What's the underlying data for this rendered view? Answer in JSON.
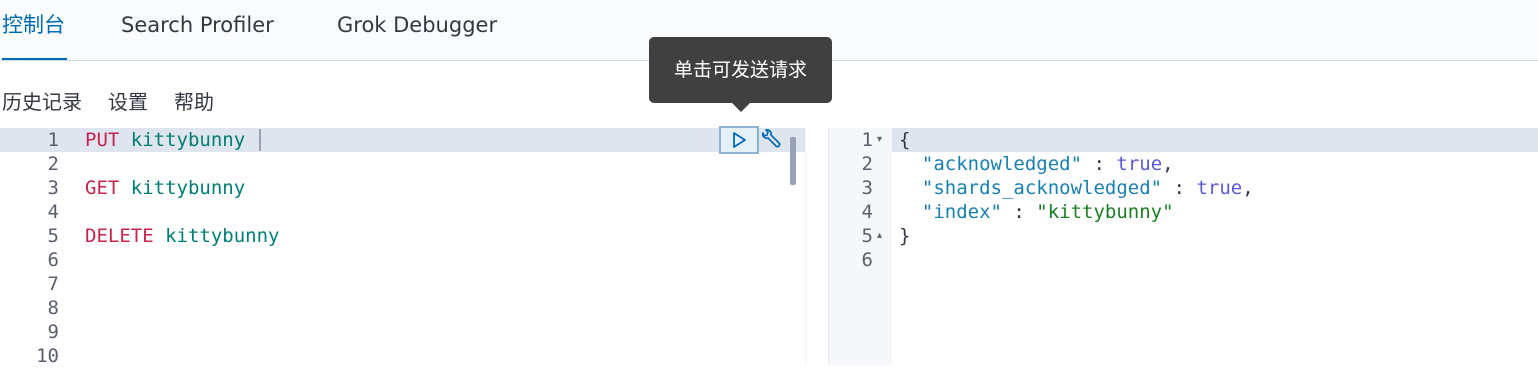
{
  "tabs": [
    {
      "label": "控制台",
      "active": true
    },
    {
      "label": "Search Profiler",
      "active": false
    },
    {
      "label": "Grok Debugger",
      "active": false
    }
  ],
  "menu": {
    "history": "历史记录",
    "settings": "设置",
    "help": "帮助"
  },
  "tooltip": {
    "text": "单击可发送请求"
  },
  "request_editor": {
    "line_numbers": [
      "1",
      "2",
      "3",
      "4",
      "5",
      "6",
      "7",
      "8",
      "9",
      "10"
    ],
    "lines": [
      {
        "method": "PUT",
        "url": "kittybunny"
      },
      {
        "method": "GET",
        "url": "kittybunny"
      },
      {
        "method": "DELETE",
        "url": "kittybunny"
      }
    ]
  },
  "response_editor": {
    "line_numbers": [
      "1",
      "2",
      "3",
      "4",
      "5",
      "6"
    ],
    "open_brace": "{",
    "close_brace": "}",
    "fields": [
      {
        "key": "\"acknowledged\"",
        "sep": " : ",
        "value": "true",
        "type": "bool",
        "trail": ","
      },
      {
        "key": "\"shards_acknowledged\"",
        "sep": " : ",
        "value": "true",
        "type": "bool",
        "trail": ","
      },
      {
        "key": "\"index\"",
        "sep": " : ",
        "value": "\"kittybunny\"",
        "type": "string",
        "trail": ""
      }
    ]
  },
  "colors": {
    "accent": "#006bb4",
    "method": "#c7254e",
    "url": "#017d73",
    "json_key": "#1a7fb1",
    "json_bool": "#5a5ad8",
    "json_string": "#1b7d24"
  }
}
